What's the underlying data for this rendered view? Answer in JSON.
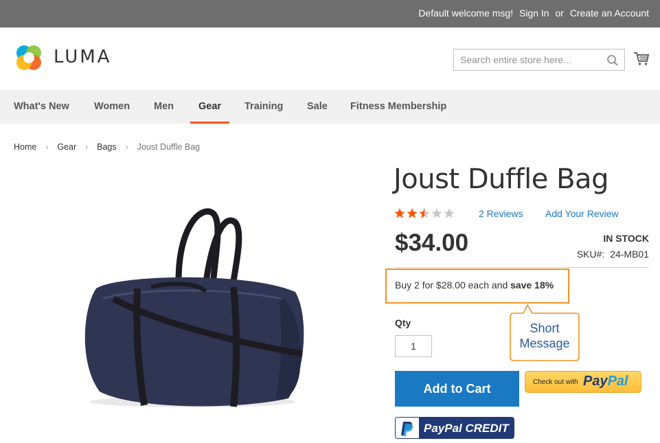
{
  "header": {
    "welcome": "Default welcome msg!",
    "sign_in": "Sign In",
    "or": "or",
    "create_account": "Create an Account",
    "logo_text": "LUMA",
    "search_placeholder": "Search entire store here..."
  },
  "nav": {
    "items": [
      "What's New",
      "Women",
      "Men",
      "Gear",
      "Training",
      "Sale",
      "Fitness Membership"
    ],
    "active": "Gear"
  },
  "breadcrumb": [
    "Home",
    "Gear",
    "Bags",
    "Joust Duffle Bag"
  ],
  "product": {
    "title": "Joust Duffle Bag",
    "rating_stars": 2.5,
    "rating_max": 5,
    "reviews": "2 Reviews",
    "add_review": "Add Your Review",
    "price": "$34.00",
    "stock": "IN STOCK",
    "sku_label": "SKU#:",
    "sku": "24-MB01",
    "tier_prefix": "Buy 2 for $28.00 each and",
    "tier_save": "save 18%",
    "qty_label": "Qty",
    "qty_value": "1",
    "add_to_cart": "Add to Cart",
    "paypal_small": "Check out with",
    "paypal_pay": "Pay",
    "paypal_pal": "Pal",
    "paypal_credit": "PayPal CREDIT"
  },
  "annotation": {
    "callout_line1": "Short",
    "callout_line2": "Message"
  },
  "colors": {
    "topbar": "#6e6e6e",
    "accent": "#ff5501",
    "link": "#1979c3",
    "highlight": "#f19125",
    "star": "#ff5501"
  }
}
